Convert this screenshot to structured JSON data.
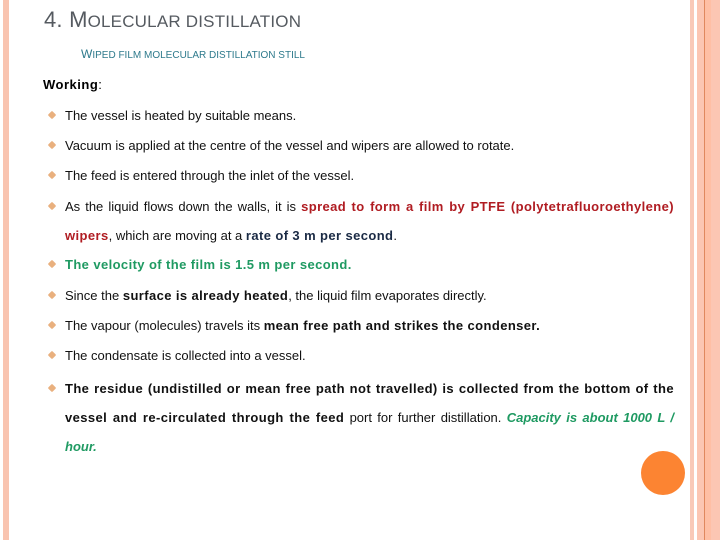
{
  "slide": {
    "title_number": "4. ",
    "title_first_letter": "M",
    "title_rest": "OLECULAR DISTILLATION",
    "subtitle_first_letter": "W",
    "subtitle_rest": "IPED FILM MOLECULAR DISTILLATION STILL",
    "working_label": "Working",
    "working_colon": ":",
    "colors": {
      "title": "#555a60",
      "subtitle": "#2e7a8c",
      "bullet": "#e9b07e",
      "highlight_red": "#b01c22",
      "highlight_navy": "#1a2a44",
      "highlight_green": "#1f9a62",
      "border": "#f9c4b0",
      "accent_circle": "#fc8432"
    }
  },
  "bullets": [
    {
      "text": "The vessel is heated by suitable means."
    },
    {
      "text": "Vacuum is applied at the centre of the vessel and wipers are allowed to rotate."
    },
    {
      "text": "The feed is entered through the inlet of the vessel."
    },
    {
      "part1": "As the liquid flows down the walls, it is ",
      "red1": "spread to form a film by PTFE (polytetrafluoroethylene) wipers",
      "part2": ", which are moving at a ",
      "navy1": "rate of 3 m per second",
      "part3": "."
    },
    {
      "green": "The velocity of the film is 1.5 m per second."
    },
    {
      "part1": "Since the ",
      "bold1": "surface is already heated",
      "part2": ", the liquid film evaporates directly."
    },
    {
      "part1": "The vapour (molecules) travels its ",
      "bold1": "mean free path and strikes the condenser."
    },
    {
      "text": "The condensate is collected into a vessel."
    },
    {
      "bold1": "The residue (undistilled or mean free path not travelled) is collected from the bottom of the vessel and re-circulated through the feed",
      "part1": " port for further distillation. ",
      "greeni": "Capacity is about 1000 L / hour."
    }
  ]
}
